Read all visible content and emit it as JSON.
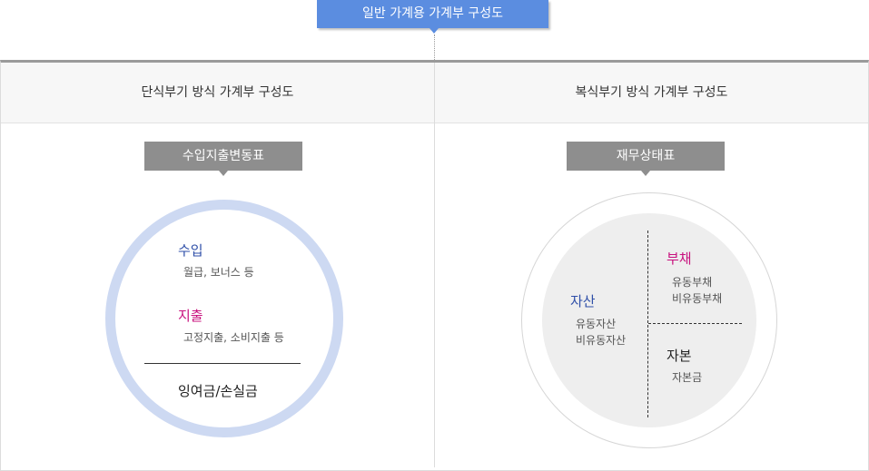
{
  "top_badge": {
    "label": "일반 가계용 가계부 구성도"
  },
  "left": {
    "title": "단식부기 방식 가계부 구성도",
    "label": "수입지출변동표",
    "income": {
      "title": "수입",
      "desc": "월급, 보너스 등"
    },
    "expense": {
      "title": "지출",
      "desc": "고정지출,  소비지출 등"
    },
    "result": "잉여금/손실금"
  },
  "right": {
    "title": "복식부기 방식 가계부 구성도",
    "label": "재무상태표",
    "assets": {
      "title": "자산",
      "items": [
        "유동자산",
        "비유동자산"
      ]
    },
    "liabilities": {
      "title": "부채",
      "items": [
        "유동부채",
        "비유동부채"
      ]
    },
    "equity": {
      "title": "자본",
      "items": [
        "자본금"
      ]
    }
  },
  "colors": {
    "accent_blue": "#5b8de0",
    "label_gray": "#8e8e8e",
    "ring_blue": "#cdd9f2",
    "income_blue": "#2f4fa8",
    "expense_pink": "#c8117e"
  }
}
